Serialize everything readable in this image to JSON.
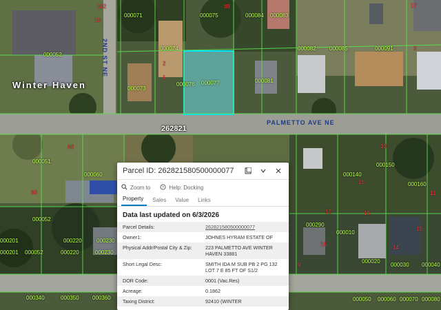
{
  "map": {
    "place_label": "Winter Haven",
    "street_label": "PALMETTO AVE NE",
    "cross_street_label": "2ND ST NE",
    "road_number_label": "262821",
    "parcel_labels": [
      "000071",
      "000075",
      "000084",
      "000083",
      "000052",
      "000074",
      "000082",
      "000085",
      "000091",
      "000073",
      "000076",
      "000077",
      "000081",
      "000051",
      "000060",
      "000150",
      "000140",
      "000160",
      "000052",
      "000290",
      "000201",
      "000220",
      "000230",
      "000052",
      "000220",
      "000230",
      "000201",
      "000010",
      "000020",
      "000030",
      "000040",
      "000340",
      "000350",
      "000360",
      "000050",
      "000060",
      "000070",
      "000080"
    ],
    "red_numbers": [
      "102",
      "10",
      "89",
      "17",
      "3",
      "2",
      "1",
      "13",
      "15",
      "18",
      "12",
      "16",
      "14",
      "15",
      "9",
      "60",
      "60",
      "11"
    ]
  },
  "popup": {
    "title": "Parcel ID: 262821580500000077",
    "zoom_label": "Zoom to",
    "help_label": "Help: Docking",
    "tabs": [
      "Property",
      "Sales",
      "Value",
      "Links"
    ],
    "active_tab": "Property",
    "updated": "Data last updated on 6/3/2026",
    "rows": [
      {
        "k": "Parcel Details:",
        "v": "262821580500000077",
        "link": true
      },
      {
        "k": "Owner1:",
        "v": "JOHNES HYRAM ESTATE OF"
      },
      {
        "k": "Physical Addr/Postal City & Zip:",
        "v": "223 PALMETTO AVE WINTER HAVEN 33881"
      },
      {
        "k": "Short Legal Desc:",
        "v": "SMITH IDA M SUB PB 2 PG 132 LOT 7 E 85 FT OF S1/2"
      },
      {
        "k": "DOR Code:",
        "v": "0001 (Vac.Res)"
      },
      {
        "k": "Acreage:",
        "v": "0.1862"
      },
      {
        "k": "Taxing District:",
        "v": "92410 (WINTER"
      }
    ]
  }
}
